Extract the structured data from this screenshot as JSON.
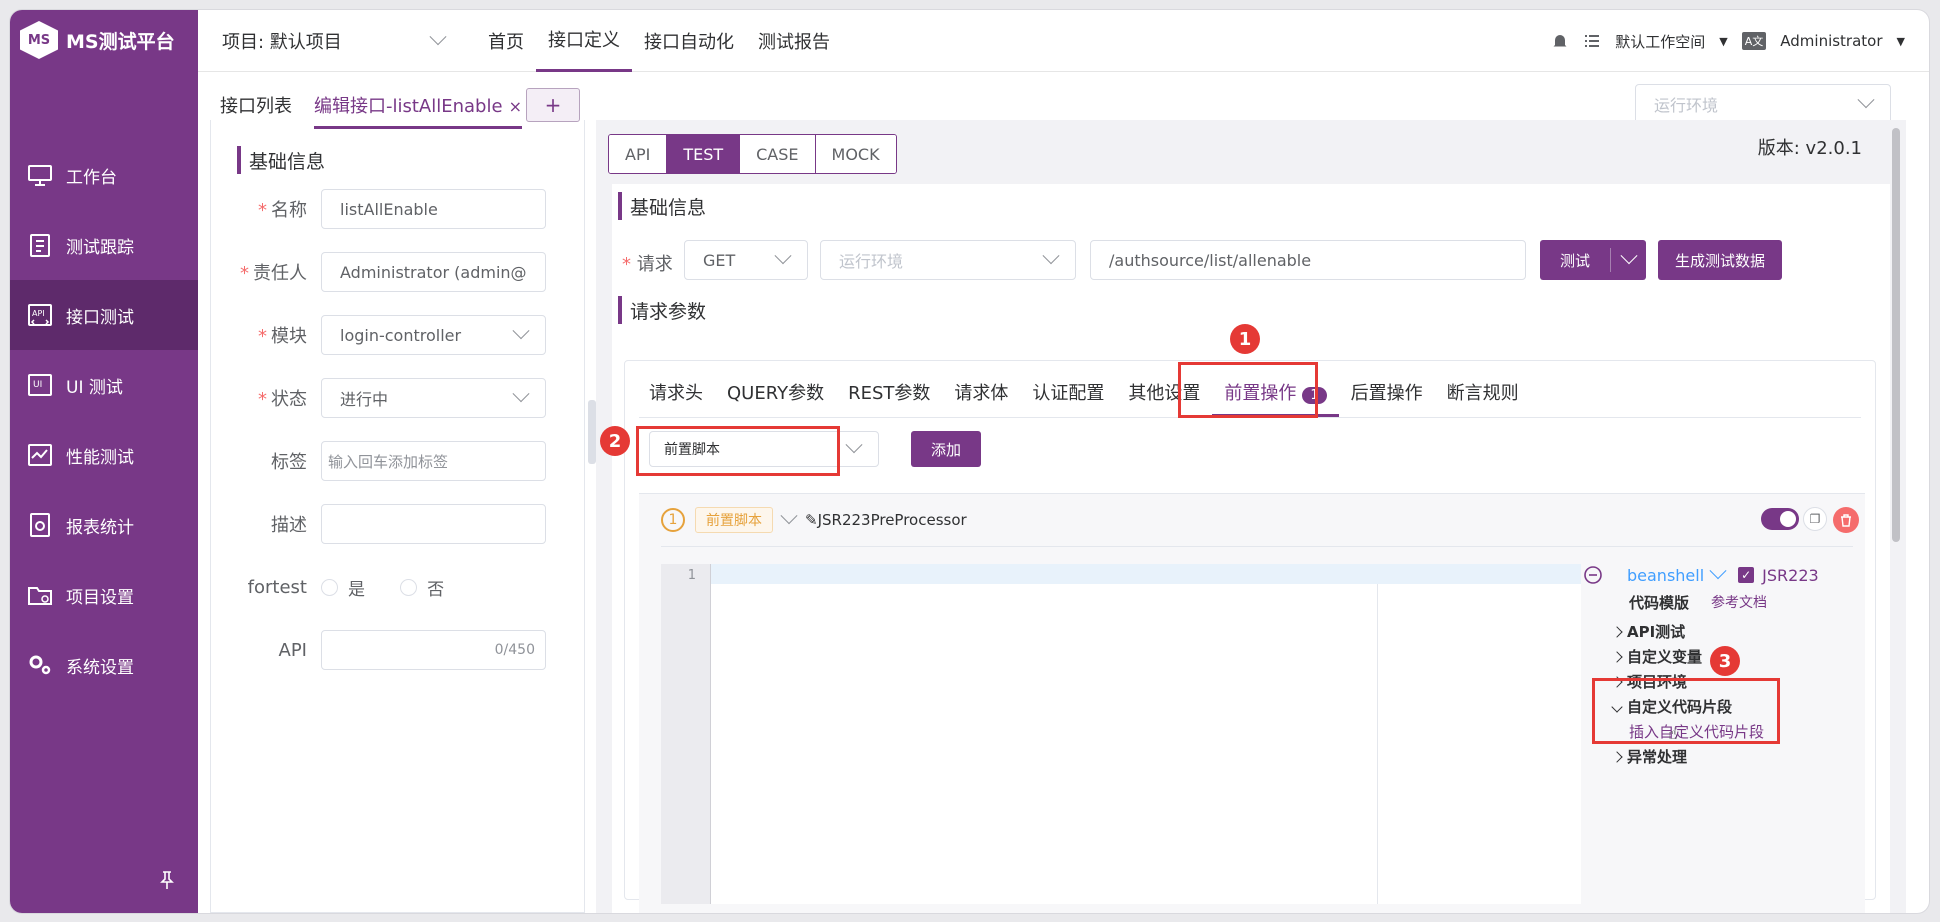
{
  "app": {
    "logo_text": "MS测试平台",
    "logo_mark": "MS"
  },
  "sidebar": {
    "items": [
      {
        "label": "工作台",
        "icon": "monitor-icon"
      },
      {
        "label": "测试跟踪",
        "icon": "clipboard-icon"
      },
      {
        "label": "接口测试",
        "icon": "api-icon",
        "active": true
      },
      {
        "label": "UI 测试",
        "icon": "ui-icon"
      },
      {
        "label": "性能测试",
        "icon": "performance-icon"
      },
      {
        "label": "报表统计",
        "icon": "report-icon"
      },
      {
        "label": "项目设置",
        "icon": "folder-settings-icon"
      },
      {
        "label": "系统设置",
        "icon": "gears-icon"
      }
    ],
    "pin_icon": "pin-icon"
  },
  "header": {
    "project": "项目: 默认项目",
    "menu": [
      "首页",
      "接口定义",
      "接口自动化",
      "测试报告"
    ],
    "active_menu": "接口定义",
    "workspace": "默认工作空间",
    "lang_icon": "A文",
    "user": "Administrator"
  },
  "tabs": {
    "list_label": "接口列表",
    "edit_label": "编辑接口-listAllEnable",
    "close": "×",
    "add": "+",
    "env_placeholder": "运行环境"
  },
  "left_form": {
    "title": "基础信息",
    "name_label": "名称",
    "name_value": "listAllEnable",
    "owner_label": "责任人",
    "owner_value": "Administrator (admin@",
    "module_label": "模块",
    "module_value": "login-controller",
    "status_label": "状态",
    "status_value": "进行中",
    "tag_label": "标签",
    "tag_placeholder": "输入回车添加标签",
    "desc_label": "描述",
    "fortest_label": "fortest",
    "yes": "是",
    "no": "否",
    "api_label": "API",
    "api_counter": "0/450"
  },
  "right": {
    "modes": [
      "API",
      "TEST",
      "CASE",
      "MOCK"
    ],
    "active_mode": "TEST",
    "version": "版本: v2.0.1",
    "basic_title": "基础信息",
    "request_label": "请求",
    "method": "GET",
    "env_placeholder": "运行环境",
    "url": "/authsource/list/allenable",
    "test_button": "测试",
    "gen_button": "生成测试数据",
    "params_title": "请求参数",
    "param_tabs": [
      "请求头",
      "QUERY参数",
      "REST参数",
      "请求体",
      "认证配置",
      "其他设置",
      "前置操作",
      "后置操作",
      "断言规则"
    ],
    "active_param_tab": "前置操作",
    "pre_count": "1",
    "pre_select": "前置脚本",
    "add_button": "添加",
    "processor": {
      "index": "1",
      "tag": "前置脚本",
      "name": "JSR223PreProcessor",
      "line_number": "1",
      "language": "beanshell",
      "jsr_label": "JSR223",
      "template_label": "代码模版",
      "doc_link": "参考文档",
      "tree": [
        "API测试",
        "自定义变量",
        "项目环境",
        "自定义代码片段",
        "异常处理"
      ],
      "expanded": "自定义代码片段",
      "insert_link": "插入自定义代码片段"
    },
    "markers": [
      "1",
      "2",
      "3"
    ]
  },
  "colors": {
    "brand": "#783887",
    "annotation": "#e53935"
  }
}
